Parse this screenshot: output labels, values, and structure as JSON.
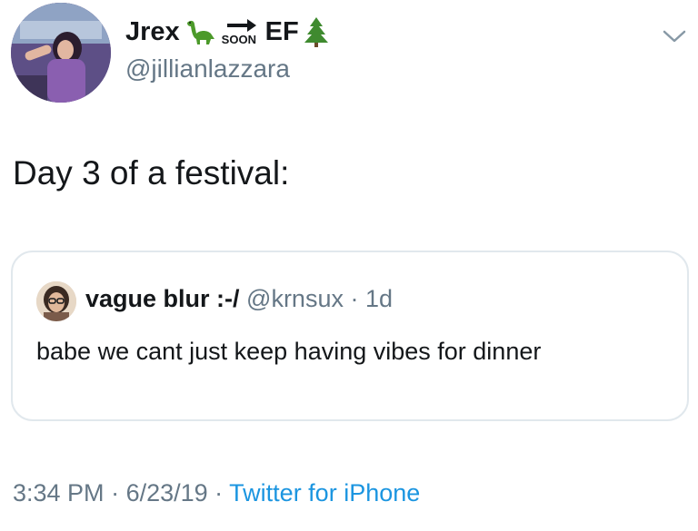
{
  "user": {
    "display_name_prefix": "Jrex",
    "soon_label": "SOON",
    "display_name_suffix": "EF",
    "handle": "@jillianlazzara"
  },
  "tweet": {
    "text": "Day 3 of a festival:"
  },
  "quoted": {
    "name": "vague blur :-/",
    "handle": "@krnsux",
    "separator": " · ",
    "age": "1d",
    "text": "babe we cant just keep having vibes for dinner"
  },
  "meta": {
    "time": "3:34 PM",
    "separator1": " · ",
    "date": "6/23/19",
    "separator2": " · ",
    "source": "Twitter for iPhone"
  },
  "colors": {
    "text": "#14171a",
    "secondary": "#657786",
    "link": "#1b95e0",
    "border": "#e1e8ed"
  },
  "icons": [
    "sauropod-emoji-icon",
    "soon-arrow-emoji-icon",
    "evergreen-tree-emoji-icon",
    "chevron-down-icon"
  ]
}
